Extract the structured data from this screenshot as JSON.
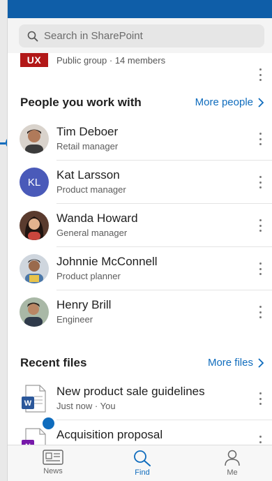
{
  "search": {
    "placeholder": "Search in SharePoint"
  },
  "group": {
    "tile_text": "UX",
    "subtitle": "Public group · 14 members"
  },
  "people_section": {
    "title": "People you work with",
    "link": "More people"
  },
  "people": [
    {
      "name": "Tim Deboer",
      "role": "Retail manager"
    },
    {
      "name": "Kat Larsson",
      "role": "Product manager",
      "initials": "KL"
    },
    {
      "name": "Wanda Howard",
      "role": "General manager"
    },
    {
      "name": "Johnnie McConnell",
      "role": "Product planner"
    },
    {
      "name": "Henry Brill",
      "role": "Engineer"
    }
  ],
  "files_section": {
    "title": "Recent files",
    "link": "More files"
  },
  "files": [
    {
      "name": "New product sale guidelines",
      "meta": "Just now · You",
      "app_letter": "W",
      "app_color": "#2b579a"
    },
    {
      "name": "Acquisition proposal",
      "app_letter": "N",
      "app_color": "#7719aa"
    }
  ],
  "tabs": [
    {
      "label": "News",
      "active": false
    },
    {
      "label": "Find",
      "active": true
    },
    {
      "label": "Me",
      "active": false
    }
  ],
  "colors": {
    "brand": "#0f5ea8",
    "accent": "#0f6cbd",
    "group_tile": "#b21818"
  }
}
